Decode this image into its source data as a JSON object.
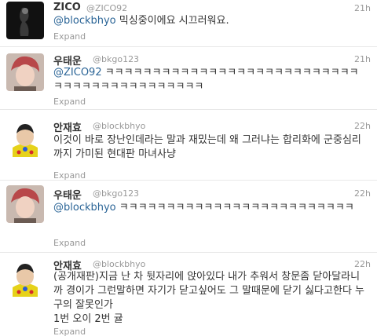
{
  "tweets": [
    {
      "name": "ZICO",
      "handle": "@ZICO92",
      "time": "21h",
      "mention": "@blockbhyo",
      "text": " 믹싱중이에요 시끄러워요.",
      "expand": "Expand"
    },
    {
      "name": "우태운",
      "handle": "@bkgo123",
      "time": "21h",
      "mention": "@ZICO92",
      "text": " ㅋㅋㅋㅋㅋㅋㅋㅋㅋㅋㅋㅋㅋㅋㅋㅋㅋㅋㅋㅋㅋㅋㅋㅋㅋㅋㅋㅋㅋㅋㅋㅋㅋㅋㅋㅋㅋㅋㅋㅋㅋㅋㅋ",
      "expand": "Expand"
    },
    {
      "name": "안재효",
      "handle": "@blockbhyo",
      "time": "22h",
      "mention": "",
      "text": "이것이 바로 장난인데라는 말과 재밌는데 왜 그러냐는 합리화에 군중심리까지 가미된 현대판 마녀사냥",
      "expand": "Expand"
    },
    {
      "name": "우태운",
      "handle": "@bkgo123",
      "time": "22h",
      "mention": "@blockbhyo",
      "text": " ㅋㅋㅋㅋㅋㅋㅋㅋㅋㅋㅋㅋㅋㅋㅋㅋㅋㅋㅋㅋㅋㅋㅋㅋㅋ",
      "expand": "Expand"
    },
    {
      "name": "안재효",
      "handle": "@blockbhyo",
      "time": "22h",
      "mention": "",
      "text": "(공개재판)지금 난 차 뒷자리에 앉아있다 내가 추워서 창문좀 닫아달라니까 경이가 그런말하면 자기가 닫고싶어도 그 말때문에 닫기 싫다고한다 누구의 잘못인가",
      "text2": "1번 오이 2번 귤",
      "expand": "Expand"
    }
  ]
}
